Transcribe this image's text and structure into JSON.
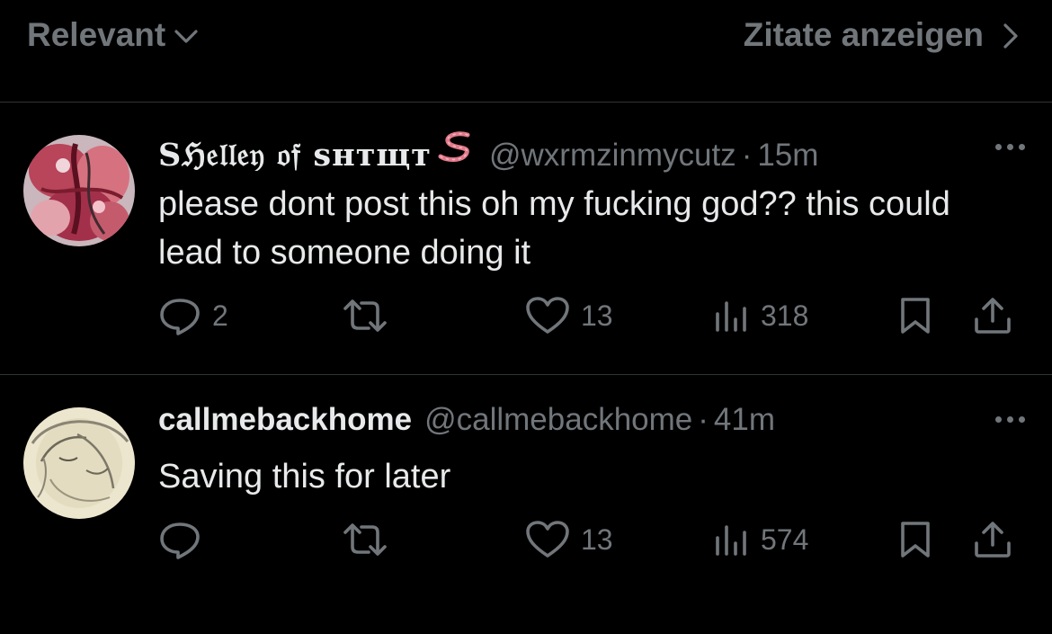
{
  "header": {
    "sort_label": "Relevant",
    "quotes_label": "Zitate anzeigen"
  },
  "replies": [
    {
      "display_name": "Sℌ𝔢𝔩𝔩𝔢𝔶 𝔬𝔣 sнтщт",
      "handle": "@wxrmzinmycutz",
      "separator": "·",
      "time": "15m",
      "text": "please dont post this oh my fucking god?? this could lead to someone doing it",
      "reply_count": "2",
      "repost_count": "",
      "like_count": "13",
      "view_count": "318"
    },
    {
      "display_name": "callmebackhome",
      "handle": "@callmebackhome",
      "separator": "·",
      "time": "41m",
      "text": "Saving this for later",
      "reply_count": "",
      "repost_count": "",
      "like_count": "13",
      "view_count": "574"
    }
  ],
  "icons": {
    "sort": "chevron-down-icon",
    "quotes": "chevron-right-icon",
    "name_emoji": "worm-icon",
    "more": "more-icon",
    "reply": "reply-icon",
    "repost": "repost-icon",
    "like": "heart-icon",
    "views": "views-icon",
    "bookmark": "bookmark-icon",
    "share": "share-icon"
  },
  "colors": {
    "background": "#000000",
    "primary_text": "#e7e9ea",
    "secondary_text": "#71767b",
    "divider": "#2f3336",
    "worm": "#e07a8a"
  }
}
